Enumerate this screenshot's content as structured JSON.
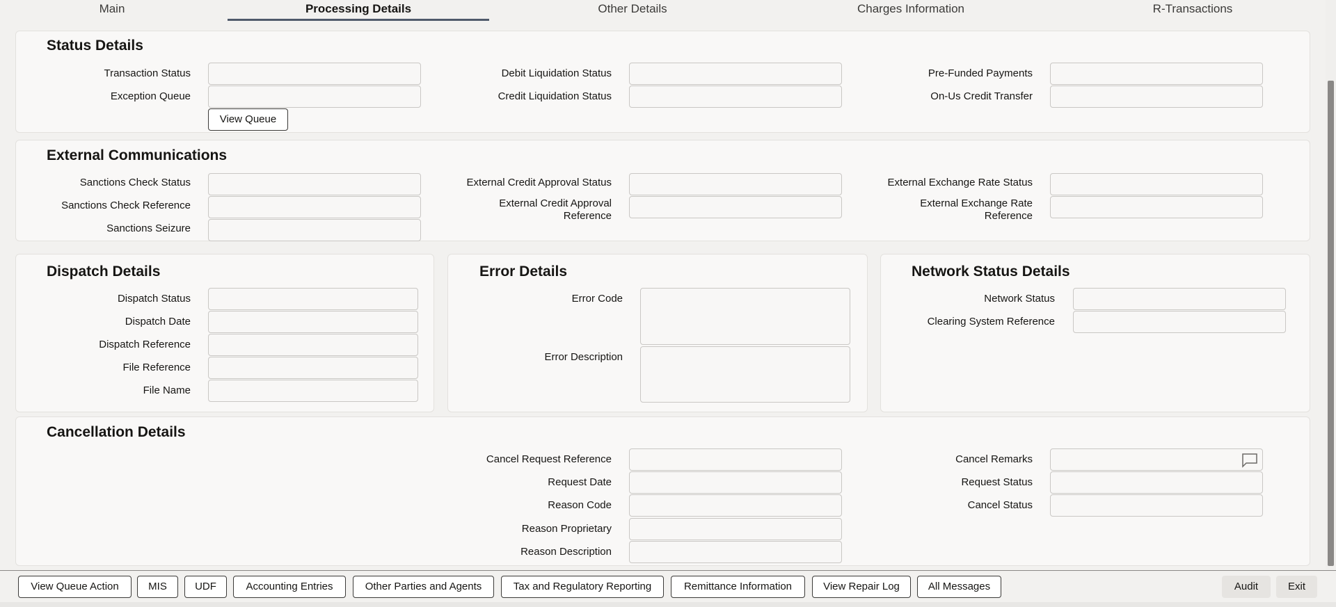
{
  "tabs": [
    "Main",
    "Processing Details",
    "Other Details",
    "Charges Information",
    "R-Transactions"
  ],
  "status": {
    "title": "Status Details",
    "transaction_status": "Transaction Status",
    "exception_queue": "Exception Queue",
    "view_queue": "View Queue",
    "debit_liquidation": "Debit Liquidation Status",
    "credit_liquidation": "Credit Liquidation Status",
    "pre_funded": "Pre-Funded Payments",
    "on_us": "On-Us Credit Transfer"
  },
  "external": {
    "title": "External Communications",
    "sanctions_status": "Sanctions Check Status",
    "sanctions_ref": "Sanctions Check Reference",
    "sanctions_seizure": "Sanctions Seizure",
    "ext_credit_status": "External Credit Approval Status",
    "ext_credit_ref_1": "External Credit Approval",
    "ext_credit_ref_2": "Reference",
    "ext_fx_status": "External Exchange Rate Status",
    "ext_fx_ref_1": "External Exchange Rate",
    "ext_fx_ref_2": "Reference"
  },
  "dispatch": {
    "title": "Dispatch Details",
    "status": "Dispatch Status",
    "date": "Dispatch Date",
    "reference": "Dispatch Reference",
    "file_ref": "File Reference",
    "file_name": "File Name"
  },
  "error": {
    "title": "Error Details",
    "code": "Error Code",
    "description": "Error Description"
  },
  "network": {
    "title": "Network Status Details",
    "status": "Network Status",
    "clearing_ref": "Clearing System Reference"
  },
  "cancellation": {
    "title": "Cancellation Details",
    "cancel_req_ref": "Cancel Request Reference",
    "request_date": "Request Date",
    "reason_code": "Reason Code",
    "reason_proprietary": "Reason Proprietary",
    "reason_description": "Reason Description",
    "cancel_remarks": "Cancel Remarks",
    "request_status": "Request Status",
    "cancel_status": "Cancel Status"
  },
  "footer": {
    "buttons": [
      "View Queue Action",
      "MIS",
      "UDF",
      "Accounting Entries",
      "Other Parties and Agents",
      "Tax and Regulatory Reporting",
      "Remittance Information",
      "View Repair Log",
      "All Messages"
    ],
    "audit": "Audit",
    "exit": "Exit"
  }
}
